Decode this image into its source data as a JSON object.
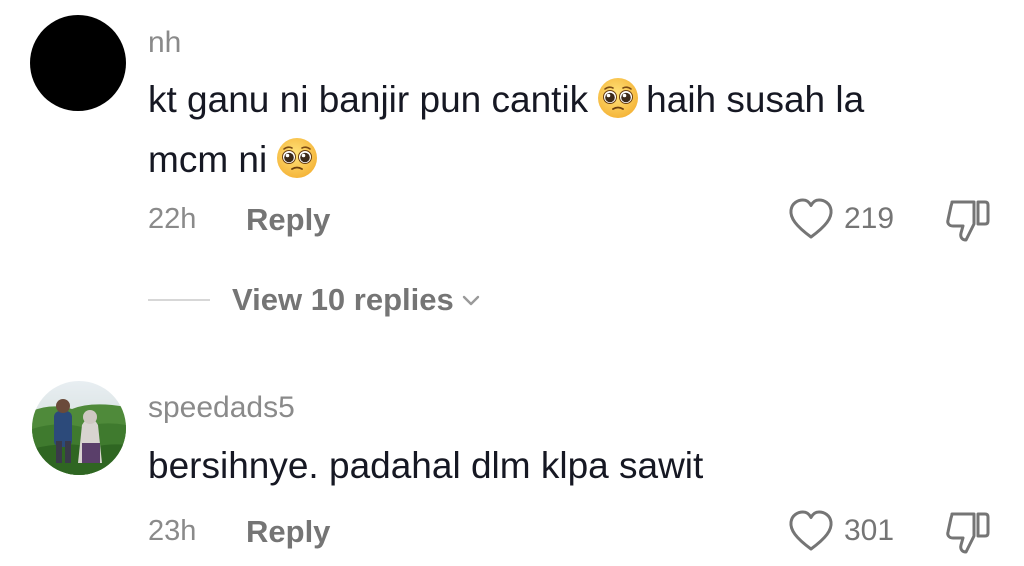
{
  "comments": [
    {
      "username": "nh",
      "text_line1_part1": "kt ganu ni banjir pun cantik",
      "text_line1_part2": "haih susah la",
      "text_line2": "mcm ni",
      "emoji": "pleading-face",
      "time": "22h",
      "reply_label": "Reply",
      "likes": "219",
      "view_replies_label": "View 10 replies"
    },
    {
      "username": "speedads5",
      "text": "bersihnye. padahal dlm klpa sawit",
      "time": "23h",
      "reply_label": "Reply",
      "likes": "301"
    }
  ],
  "icons": {
    "like": "heart-outline-icon",
    "dislike": "thumbs-down-icon",
    "expand": "chevron-down-icon"
  },
  "colors": {
    "primary_text": "#161823",
    "secondary_text": "#8a8a8a",
    "action_text": "#757575"
  }
}
